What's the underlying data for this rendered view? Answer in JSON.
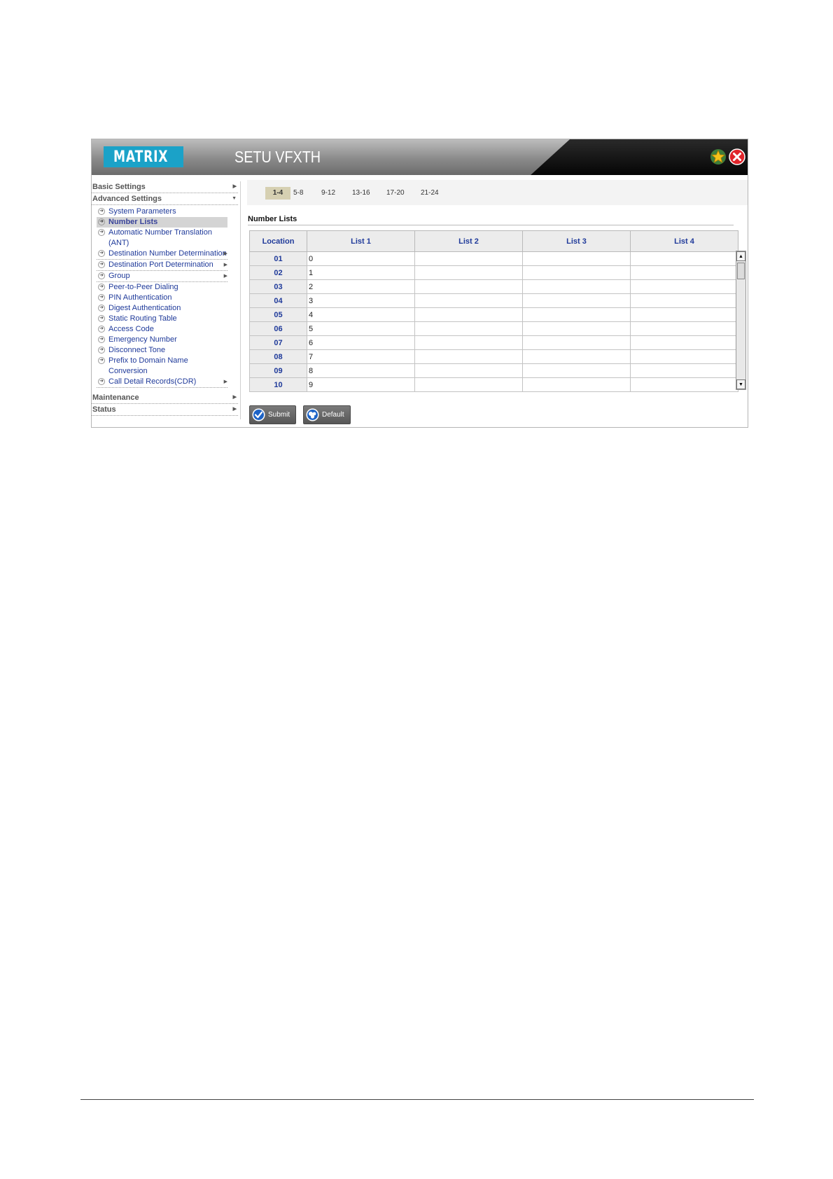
{
  "header": {
    "logo_text": "MATRIX",
    "title": "SETU VFXTH",
    "icons": [
      "star-icon",
      "close-icon"
    ]
  },
  "sidebar": {
    "basic_settings": "Basic Settings",
    "advanced_settings": "Advanced Settings",
    "items": [
      {
        "label": "System Parameters"
      },
      {
        "label": "Number Lists",
        "active": true
      },
      {
        "label": "Automatic Number Translation"
      },
      {
        "label": "(ANT)"
      },
      {
        "label": "Destination Number Determination"
      },
      {
        "label": "Destination Port Determination"
      },
      {
        "label": "Group"
      },
      {
        "label": "Peer-to-Peer Dialing"
      },
      {
        "label": "PIN Authentication"
      },
      {
        "label": "Digest Authentication"
      },
      {
        "label": "Static Routing Table"
      },
      {
        "label": "Access Code"
      },
      {
        "label": "Emergency Number"
      },
      {
        "label": "Disconnect Tone"
      },
      {
        "label": "Prefix to Domain Name Conversion"
      },
      {
        "label": "Call Detail Records(CDR)"
      }
    ],
    "maintenance": "Maintenance",
    "status": "Status"
  },
  "range_tabs": [
    "1-4",
    "5-8",
    "9-12",
    "13-16",
    "17-20",
    "21-24"
  ],
  "active_range": "1-4",
  "section_title": "Number Lists",
  "table": {
    "headers": [
      "Location",
      "List 1",
      "List 2",
      "List 3",
      "List 4"
    ],
    "rows": [
      [
        "01",
        "0",
        "",
        "",
        ""
      ],
      [
        "02",
        "1",
        "",
        "",
        ""
      ],
      [
        "03",
        "2",
        "",
        "",
        ""
      ],
      [
        "04",
        "3",
        "",
        "",
        ""
      ],
      [
        "05",
        "4",
        "",
        "",
        ""
      ],
      [
        "06",
        "5",
        "",
        "",
        ""
      ],
      [
        "07",
        "6",
        "",
        "",
        ""
      ],
      [
        "08",
        "7",
        "",
        "",
        ""
      ],
      [
        "09",
        "8",
        "",
        "",
        ""
      ],
      [
        "10",
        "9",
        "",
        "",
        ""
      ]
    ]
  },
  "buttons": {
    "submit": "Submit",
    "default": "Default"
  },
  "colors": {
    "logo_bg": "#1ba2c8",
    "link": "#1f3a9a",
    "active_tab": "#d6d0b2"
  }
}
